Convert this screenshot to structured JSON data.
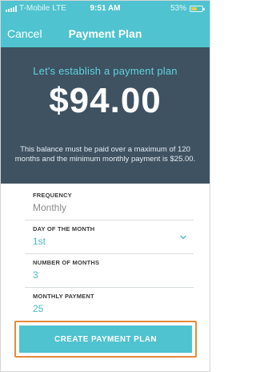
{
  "status_bar": {
    "carrier": "T-Mobile",
    "network": "LTE",
    "time": "9:51 AM",
    "battery_percent": "53%",
    "battery_level": 0.53
  },
  "nav": {
    "cancel_label": "Cancel",
    "title": "Payment Plan"
  },
  "hero": {
    "headline": "Let's establish a payment plan",
    "amount": "$94.00",
    "note": "This balance must be paid over a maximum of 120 months and the minimum monthly payment is $25.00."
  },
  "form": {
    "frequency": {
      "label": "FREQUENCY",
      "value": "Monthly"
    },
    "day_of_month": {
      "label": "DAY OF THE MONTH",
      "value": "1st"
    },
    "number_of_months": {
      "label": "NUMBER OF MONTHS",
      "value": "3"
    },
    "monthly_payment": {
      "label": "MONTHLY PAYMENT",
      "value": "25"
    }
  },
  "actions": {
    "create_label": "CREATE PAYMENT PLAN"
  },
  "colors": {
    "accent": "#4fc3cf",
    "hero_bg": "#3e5262",
    "highlight_outline": "#e38a3a"
  }
}
